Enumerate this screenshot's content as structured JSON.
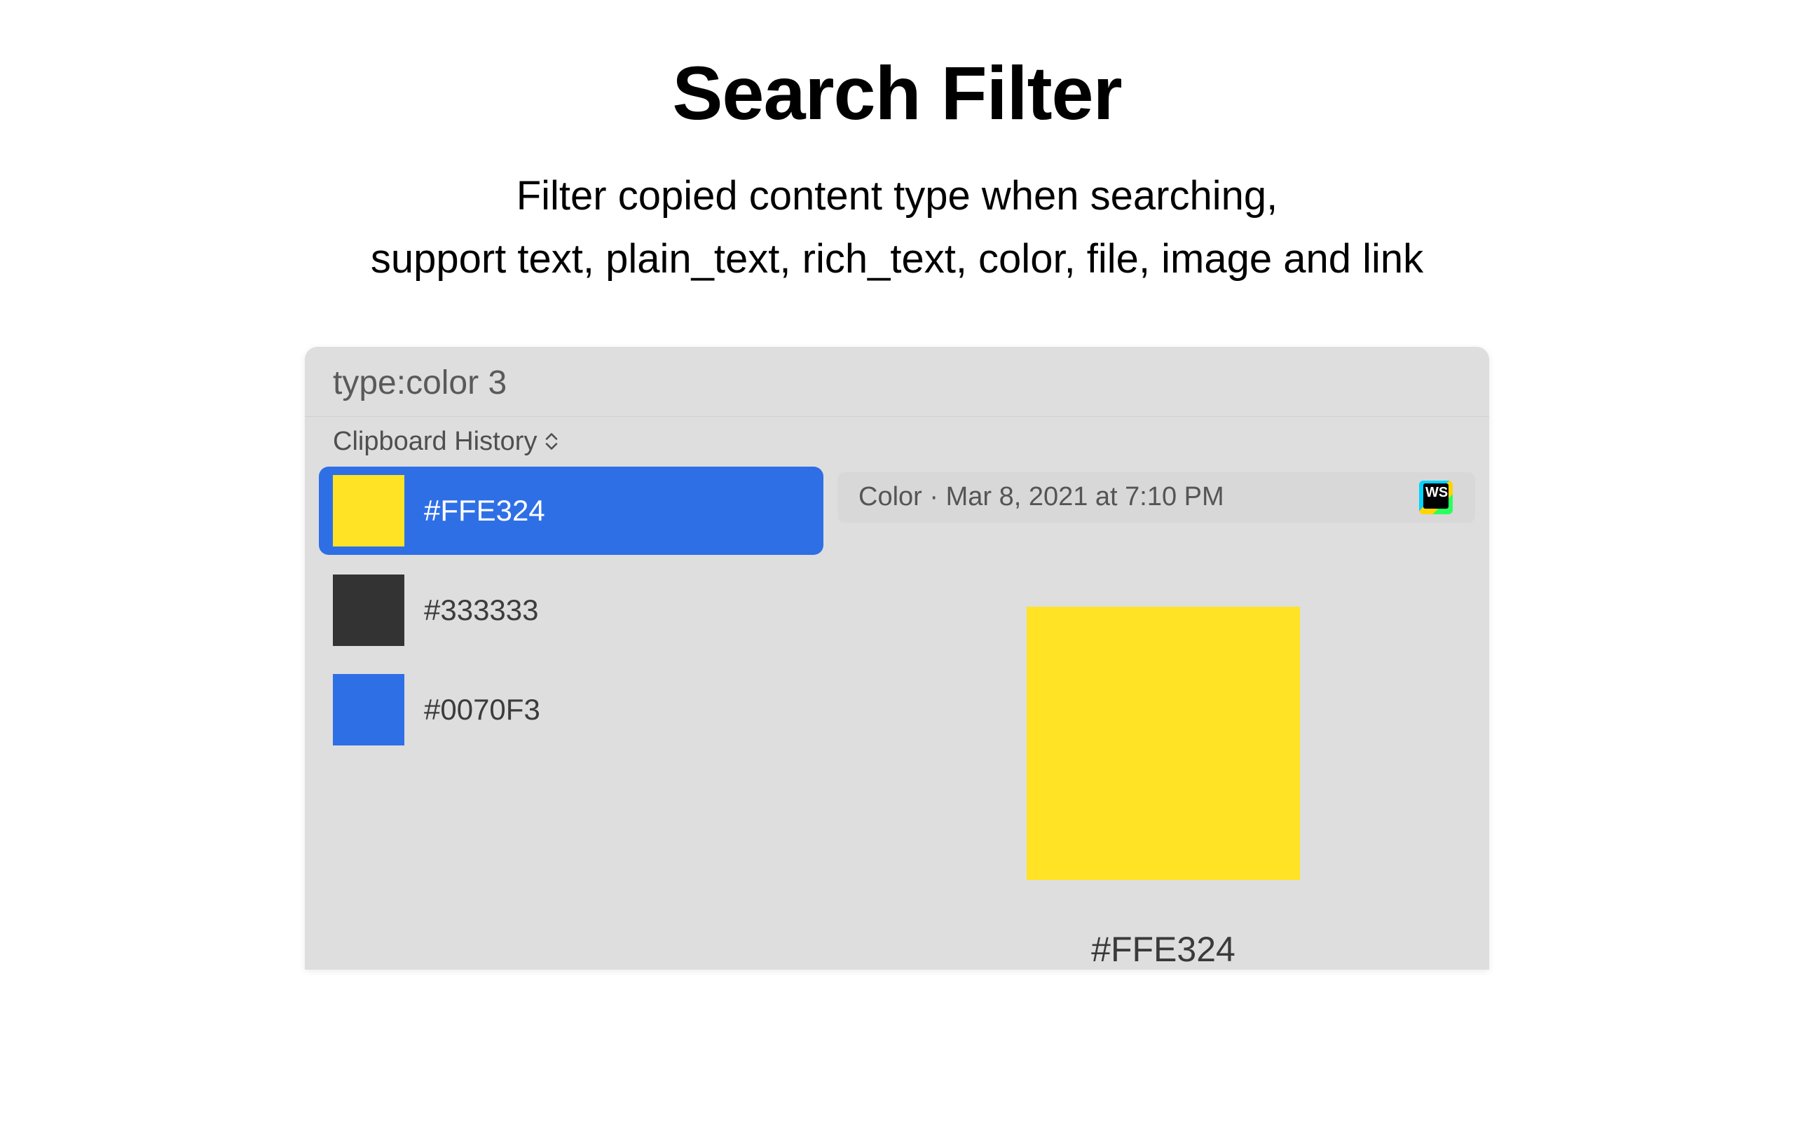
{
  "hero": {
    "title": "Search Filter",
    "subtitle_line1": "Filter copied content type when searching,",
    "subtitle_line2": "support text, plain_text, rich_text, color, file, image and link"
  },
  "search": {
    "query": "type:color 3"
  },
  "section": {
    "label": "Clipboard History"
  },
  "items": [
    {
      "hex": "#FFE324",
      "swatch": "#FFE324",
      "selected": true
    },
    {
      "hex": "#333333",
      "swatch": "#333333",
      "selected": false
    },
    {
      "hex": "#0070F3",
      "swatch": "#2f6fe6",
      "selected": false
    }
  ],
  "detail": {
    "meta": "Color · Mar 8, 2021 at 7:10 PM",
    "source_app": "WebStorm",
    "preview_swatch": "#FFE324",
    "preview_label": "#FFE324"
  },
  "colors": {
    "selection": "#2f6fe6",
    "panel": "#dedede"
  }
}
